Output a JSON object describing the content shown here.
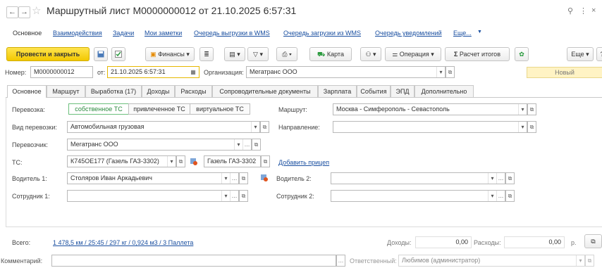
{
  "window": {
    "title": "Маршрутный лист М0000000012 от 21.10.2025 6:57:31",
    "back_glyph": "←",
    "forward_glyph": "→",
    "link_glyph": "⚲",
    "menu_glyph": "⋮",
    "close_glyph": "×"
  },
  "nav_links": [
    "Основное",
    "Взаимодействия",
    "Задачи",
    "Мои заметки",
    "Очередь выгрузки в WMS",
    "Очередь загрузки из WMS",
    "Очередь уведомлений",
    "Еще..."
  ],
  "toolbar": {
    "post_close": "Провести и закрыть",
    "finances": "Финансы",
    "map": "Карта",
    "operation": "Операция",
    "calc_totals": "Расчет итогов",
    "more": "Еще",
    "help": "?"
  },
  "header": {
    "number_label": "Номер:",
    "number_value": "М0000000012",
    "date_label": "от:",
    "date_value": "21.10.2025  6:57:31",
    "org_label": "Организация:",
    "org_value": "Мегатранс ООО",
    "status": "Новый"
  },
  "tabs": [
    "Основное",
    "Маршрут",
    "Выработка (17)",
    "Доходы",
    "Расходы",
    "Сопроводительные документы",
    "Зарплата",
    "События",
    "ЭПД",
    "Дополнительно"
  ],
  "form": {
    "transport_label": "Перевозка:",
    "transport_options": [
      "собственное ТС",
      "привлеченное ТС",
      "виртуальное ТС"
    ],
    "kind_label": "Вид перевозки:",
    "kind_value": "Автомобильная грузовая",
    "carrier_label": "Перевозчик:",
    "carrier_value": "Мегатранс ООО",
    "vehicle_label": "ТС:",
    "vehicle_value": "К745ОЕ177 (Газель ГАЗ-3302)",
    "vehicle_model": "Газель ГАЗ-3302",
    "add_trailer": "Добавить прицеп",
    "driver1_label": "Водитель 1:",
    "driver1_value": "Столяров Иван Аркадьевич",
    "employee1_label": "Сотрудник 1:",
    "employee1_value": "",
    "route_label": "Маршрут:",
    "route_value": "Москва - Симферополь - Севастополь",
    "direction_label": "Направление:",
    "direction_value": "",
    "driver2_label": "Водитель 2:",
    "driver2_value": "",
    "employee2_label": "Сотрудник 2:",
    "employee2_value": ""
  },
  "footer": {
    "total_label": "Всего:",
    "total_value": "1 478,5 км / 25:45 / 297 кг / 0,924 м3 / 3 Паллета",
    "income_label": "Доходы:",
    "income_value": "0,00",
    "expense_label": "Расходы:",
    "expense_value": "0,00",
    "currency": "р.",
    "comment_label": "Комментарий:",
    "responsible_label": "Ответственный:",
    "responsible_value": "Любимов (администратор)"
  },
  "colors": {
    "accent_yellow": "#f2c800",
    "link": "#1a4fa0",
    "status_bg": "#fff3c4",
    "active_seg": "#2a8a3e"
  }
}
